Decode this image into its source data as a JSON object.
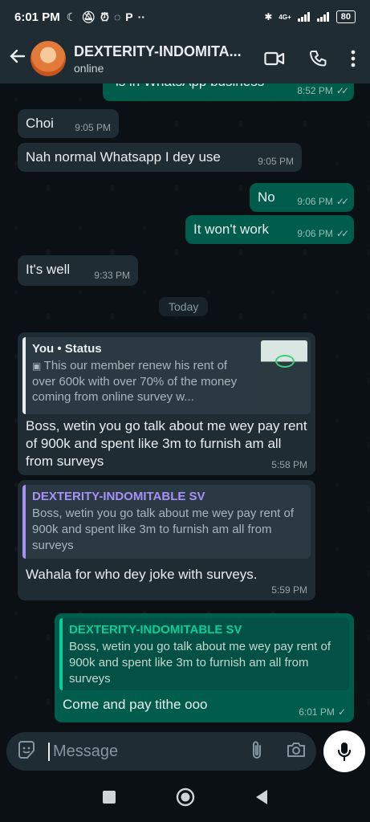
{
  "status_bar": {
    "time": "6:01 PM",
    "left_icons": [
      "moon-icon",
      "mute-icon",
      "alarm-icon",
      "whatsapp-icon",
      "p-icon",
      "more-dots-icon"
    ],
    "network": "4G+",
    "battery": "80"
  },
  "header": {
    "contact_name": "DEXTERITY-INDOMITA...",
    "contact_status": "online"
  },
  "date_divider": "Today",
  "messages": [
    {
      "dir": "out",
      "text": "is in WhatsApp business",
      "time": "8:52 PM",
      "status": "read"
    },
    {
      "dir": "in",
      "text": "Choi",
      "time": "9:05 PM"
    },
    {
      "dir": "in",
      "text": "Nah normal Whatsapp I dey use",
      "time": "9:05 PM"
    },
    {
      "dir": "out",
      "text": "No",
      "time": "9:06 PM",
      "status": "read"
    },
    {
      "dir": "out",
      "text": "It won't work",
      "time": "9:06 PM",
      "status": "read"
    },
    {
      "dir": "in",
      "text": "It's well",
      "time": "9:33 PM"
    },
    {
      "dir": "in",
      "quote_author": "You • Status",
      "quote_text": "This our member renew his rent of over 600k with over 70% of the money coming from online survey w...",
      "text": "Boss, wetin you go talk about me wey pay rent of 900k and spent like 3m to furnish am all from surveys",
      "time": "5:58 PM"
    },
    {
      "dir": "in",
      "quote_author": "DEXTERITY-INDOMITABLE SV",
      "quote_text": "Boss, wetin you go talk about me wey pay rent of 900k and spent like 3m to furnish am all from surveys",
      "text": "Wahala for who dey joke with surveys.",
      "time": "5:59 PM"
    },
    {
      "dir": "out",
      "quote_author": "DEXTERITY-INDOMITABLE SV",
      "quote_text": "Boss, wetin you go talk about me wey pay rent of 900k and spent like 3m to furnish am all from surveys",
      "text": "Come and pay tithe ooo",
      "time": "6:01 PM",
      "status": "sent"
    }
  ],
  "composer": {
    "placeholder": "Message"
  },
  "colors": {
    "header_bg": "#1f2c34",
    "incoming_bubble": "#1f2c34",
    "outgoing_bubble": "#005c4b",
    "status_quote_bar": "#e9edef",
    "contact_quote_bar": "#a791f7",
    "outgoing_quote_bar": "#06cf9c",
    "contact_quote_author": "#a791f7",
    "outgoing_quote_author": "#06cf9c"
  }
}
